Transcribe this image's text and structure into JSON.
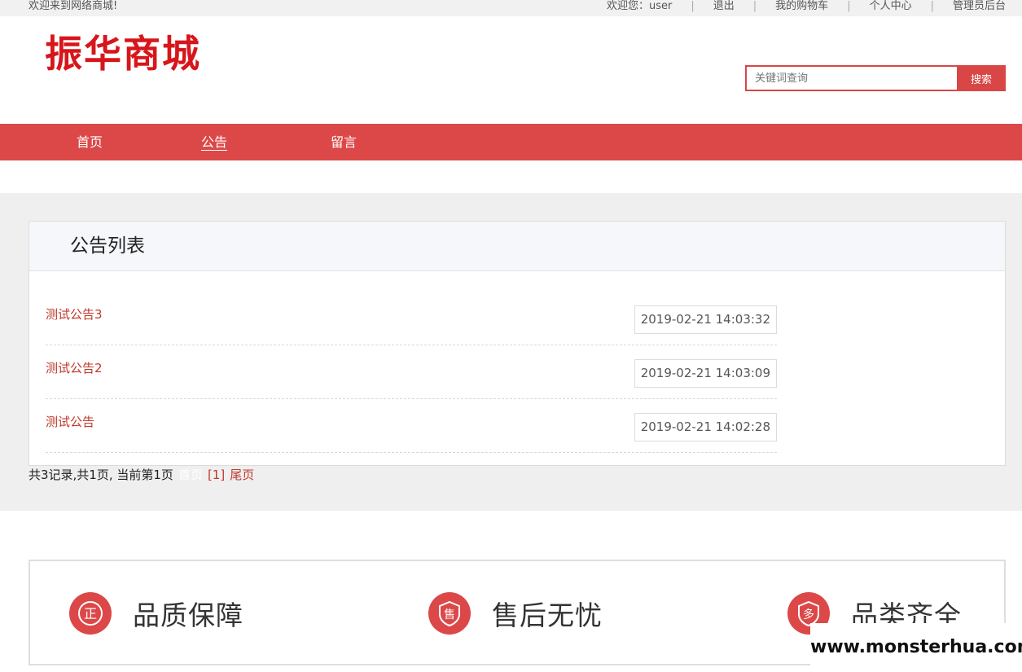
{
  "topbar": {
    "welcome": "欢迎来到网络商城!",
    "user_greeting": "欢迎您：user",
    "logout": "退出",
    "cart": "我的购物车",
    "profile": "个人中心",
    "admin": "管理员后台",
    "separator": "|"
  },
  "header": {
    "logo": "振华商城",
    "search_placeholder": "关键词查询",
    "search_button": "搜索"
  },
  "nav": {
    "items": [
      "首页",
      "公告",
      "留言"
    ],
    "active": "公告"
  },
  "panel": {
    "title": "公告列表",
    "notices": [
      {
        "title": "测试公告3",
        "date": "2019-02-21 14:03:32"
      },
      {
        "title": "测试公告2",
        "date": "2019-02-21 14:03:09"
      },
      {
        "title": "测试公告",
        "date": "2019-02-21 14:02:28"
      }
    ]
  },
  "pager": {
    "summary": "共3记录,共1页, 当前第1页",
    "first": "首页",
    "current": "[1]",
    "last": "尾页"
  },
  "features": {
    "items": [
      {
        "label": "品质保障",
        "badge": "正",
        "icon": "certificate-icon"
      },
      {
        "label": "售后无忧",
        "badge": "售",
        "icon": "shield-icon"
      },
      {
        "label": "品类齐全",
        "badge": "多",
        "icon": "badge-icon"
      }
    ]
  },
  "watermark": "www.monsterhua.com",
  "colors": {
    "brand_red": "#dc4848",
    "logo_red": "#d7161b",
    "link_red": "#c0392b"
  }
}
